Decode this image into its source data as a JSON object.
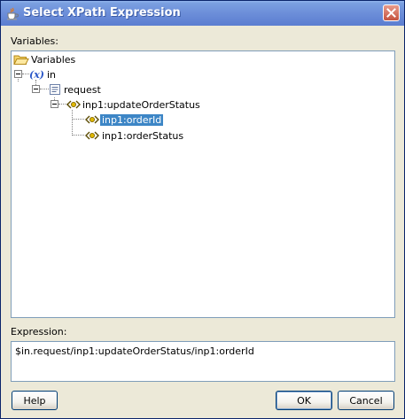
{
  "window": {
    "title": "Select XPath Expression",
    "icon": "java-cup-icon",
    "close": "close-icon"
  },
  "variables_label": "Variables:",
  "tree": {
    "root": "Variables",
    "in": "in",
    "request": "request",
    "update": "inp1:updateOrderStatus",
    "order_id": "inp1:orderId",
    "order_status": "inp1:orderStatus",
    "selected": "inp1:orderId"
  },
  "expression_label": "Expression:",
  "expression_value": "$in.request/inp1:updateOrderStatus/inp1:orderId",
  "buttons": {
    "help": "Help",
    "ok": "OK",
    "cancel": "Cancel"
  },
  "colors": {
    "titlebar": "#6C8ED9",
    "selection": "#3D86C6",
    "close": "#C4533F"
  }
}
